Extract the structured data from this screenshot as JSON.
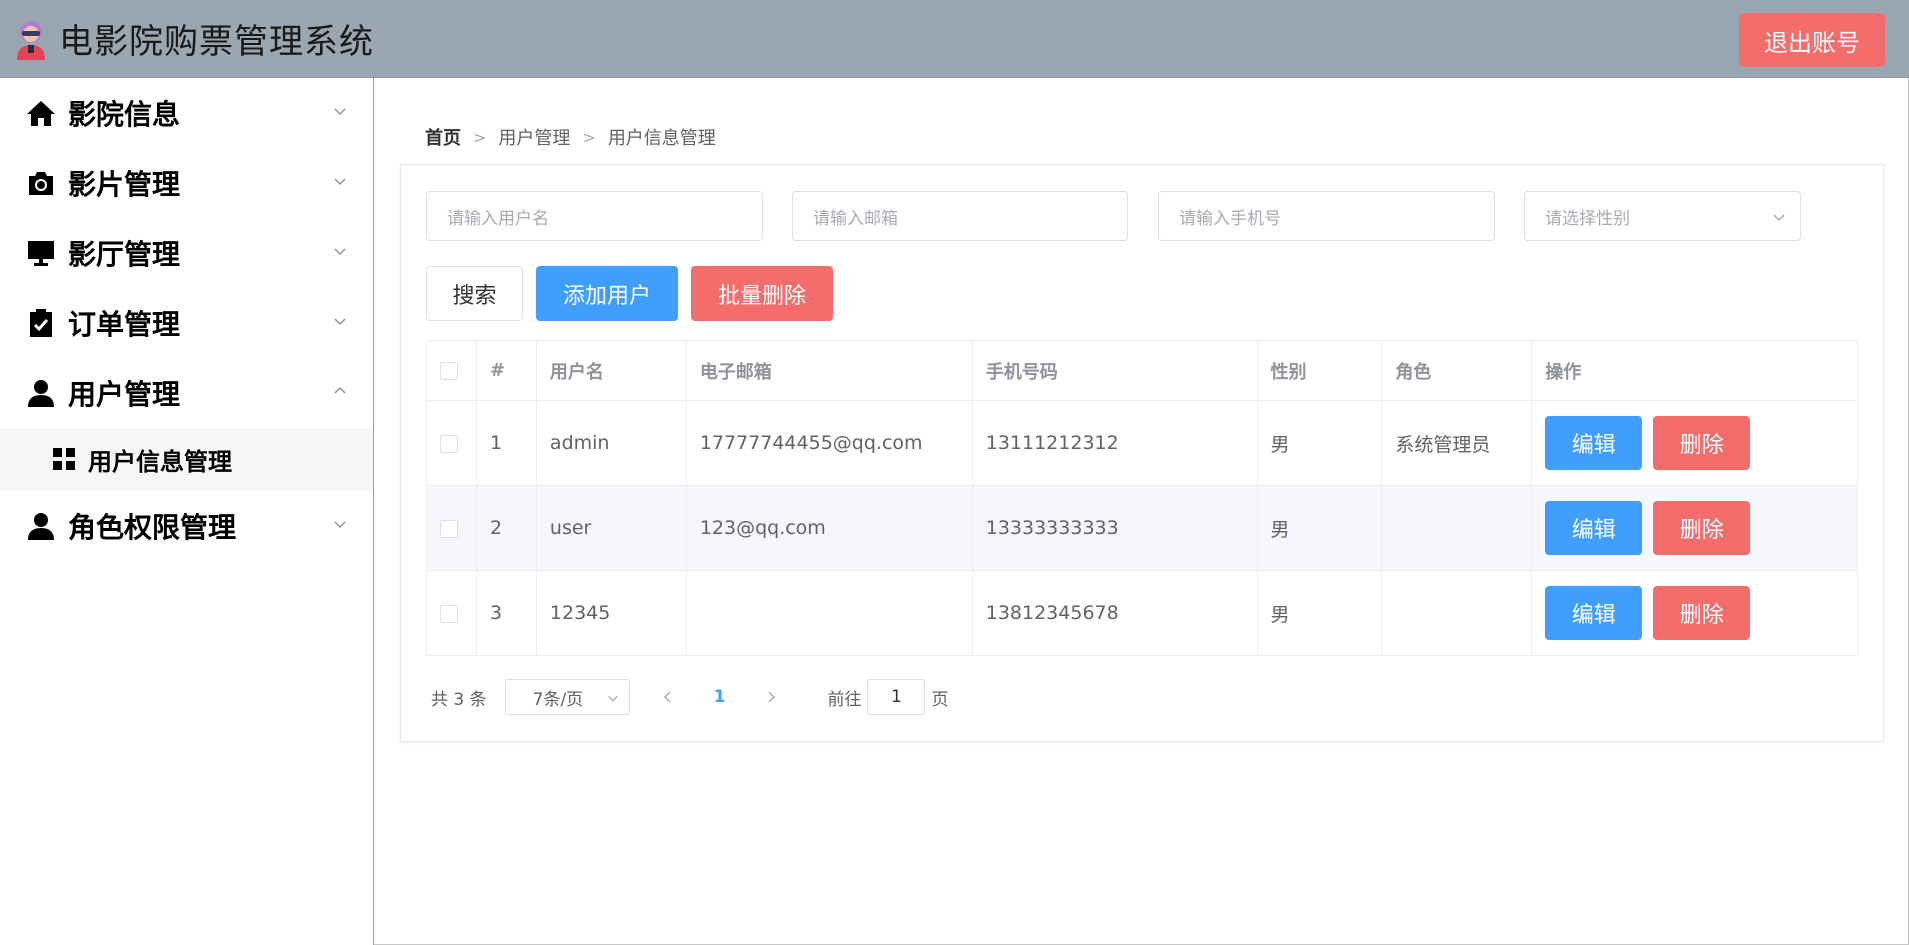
{
  "header": {
    "title": "电影院购票管理系统",
    "logout_label": "退出账号"
  },
  "sidebar": {
    "items": [
      {
        "label": "影院信息",
        "icon": "home-icon"
      },
      {
        "label": "影片管理",
        "icon": "camera-icon"
      },
      {
        "label": "影厅管理",
        "icon": "monitor-icon"
      },
      {
        "label": "订单管理",
        "icon": "clipboard-check-icon"
      },
      {
        "label": "用户管理",
        "icon": "user-icon",
        "expanded": true
      },
      {
        "label": "角色权限管理",
        "icon": "user-icon"
      }
    ],
    "subitem": {
      "label": "用户信息管理",
      "icon": "grid-icon"
    }
  },
  "breadcrumb": [
    "首页",
    "用户管理",
    "用户信息管理"
  ],
  "filters": {
    "username_placeholder": "请输入用户名",
    "email_placeholder": "请输入邮箱",
    "phone_placeholder": "请输入手机号",
    "gender_placeholder": "请选择性别"
  },
  "buttons": {
    "search": "搜索",
    "add": "添加用户",
    "batch_delete": "批量删除"
  },
  "table": {
    "headers": [
      "#",
      "用户名",
      "电子邮箱",
      "手机号码",
      "性别",
      "角色",
      "操作"
    ],
    "rows": [
      {
        "id": "1",
        "username": "admin",
        "email": "17777744455@qq.com",
        "phone": "13111212312",
        "gender": "男",
        "role": "系统管理员"
      },
      {
        "id": "2",
        "username": "user",
        "email": "123@qq.com",
        "phone": "13333333333",
        "gender": "男",
        "role": ""
      },
      {
        "id": "3",
        "username": "12345",
        "email": "",
        "phone": "13812345678",
        "gender": "男",
        "role": ""
      }
    ],
    "edit_label": "编辑",
    "delete_label": "删除"
  },
  "pagination": {
    "total": "共 3 条",
    "page_size": "7条/页",
    "current": "1",
    "goto_prefix": "前往",
    "goto_value": "1",
    "goto_suffix": "页"
  },
  "colors": {
    "header_bg": "#9aa6b1",
    "primary": "#409eff",
    "danger": "#f56c6c"
  }
}
